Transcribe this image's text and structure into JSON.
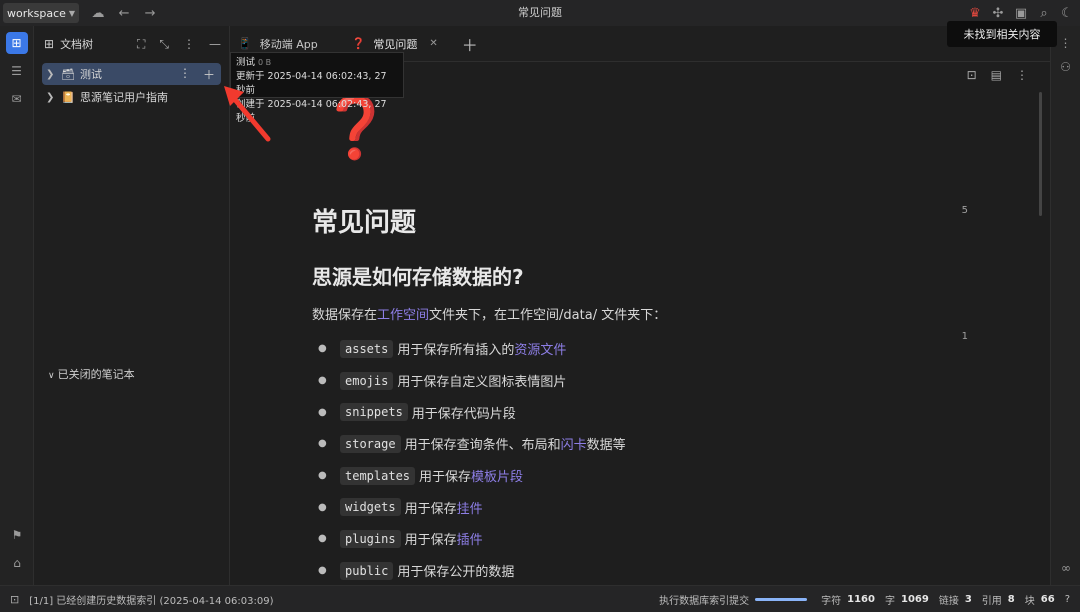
{
  "titlebar": {
    "workspace": "workspace",
    "title": "常见问题"
  },
  "tree": {
    "header": "文档树",
    "notebooks": [
      {
        "label": "测试",
        "icon": "🗃"
      },
      {
        "label": "思源笔记用户指南",
        "icon": "📔"
      }
    ],
    "closed_label": "已关闭的笔记本"
  },
  "tabs": [
    {
      "label": "移动端 App",
      "icon": "📱"
    },
    {
      "label": "常见问题",
      "icon": "❓"
    }
  ],
  "tooltip": {
    "name": "测试",
    "size": "0 B",
    "updated": "更新于 2025-04-14 06:02:43, 27 秒前",
    "created": "创建于 2025-04-14 06:02:43, 27 秒前"
  },
  "notice": "未找到相关内容",
  "doc": {
    "icon": "❓",
    "h1": "常见问题",
    "h2": "思源是如何存储数据的?",
    "para_prefix": "数据保存在",
    "para_link": "工作空间",
    "para_suffix": "文件夹下，在工作空间/data/ 文件夹下：",
    "items": [
      {
        "code": "assets",
        "text": "用于保存所有插入的",
        "link": "资源文件",
        "tail": ""
      },
      {
        "code": "emojis",
        "text": "用于保存自定义图标表情图片",
        "link": "",
        "tail": ""
      },
      {
        "code": "snippets",
        "text": "用于保存代码片段",
        "link": "",
        "tail": ""
      },
      {
        "code": "storage",
        "text": "用于保存查询条件、布局和",
        "link": "闪卡",
        "tail": "数据等"
      },
      {
        "code": "templates",
        "text": "用于保存",
        "link": "模板片段",
        "tail": ""
      },
      {
        "code": "widgets",
        "text": "用于保存",
        "link": "挂件",
        "tail": ""
      },
      {
        "code": "plugins",
        "text": "用于保存",
        "link": "插件",
        "tail": ""
      },
      {
        "code": "public",
        "text": "用于保存公开的数据",
        "link": "",
        "tail": ""
      }
    ],
    "margin_counts": [
      "5",
      "1"
    ]
  },
  "status": {
    "message": "[1/1] 已经创建历史数据索引 (2025-04-14 06:03:09)",
    "task": "执行数据库索引提交",
    "progress": 1.0,
    "chars_label": "字符",
    "chars": "1160",
    "words_label": "字",
    "words": "1069",
    "links_label": "链接",
    "links": "3",
    "refs_label": "引用",
    "refs": "8",
    "blocks_label": "块",
    "blocks": "66"
  }
}
